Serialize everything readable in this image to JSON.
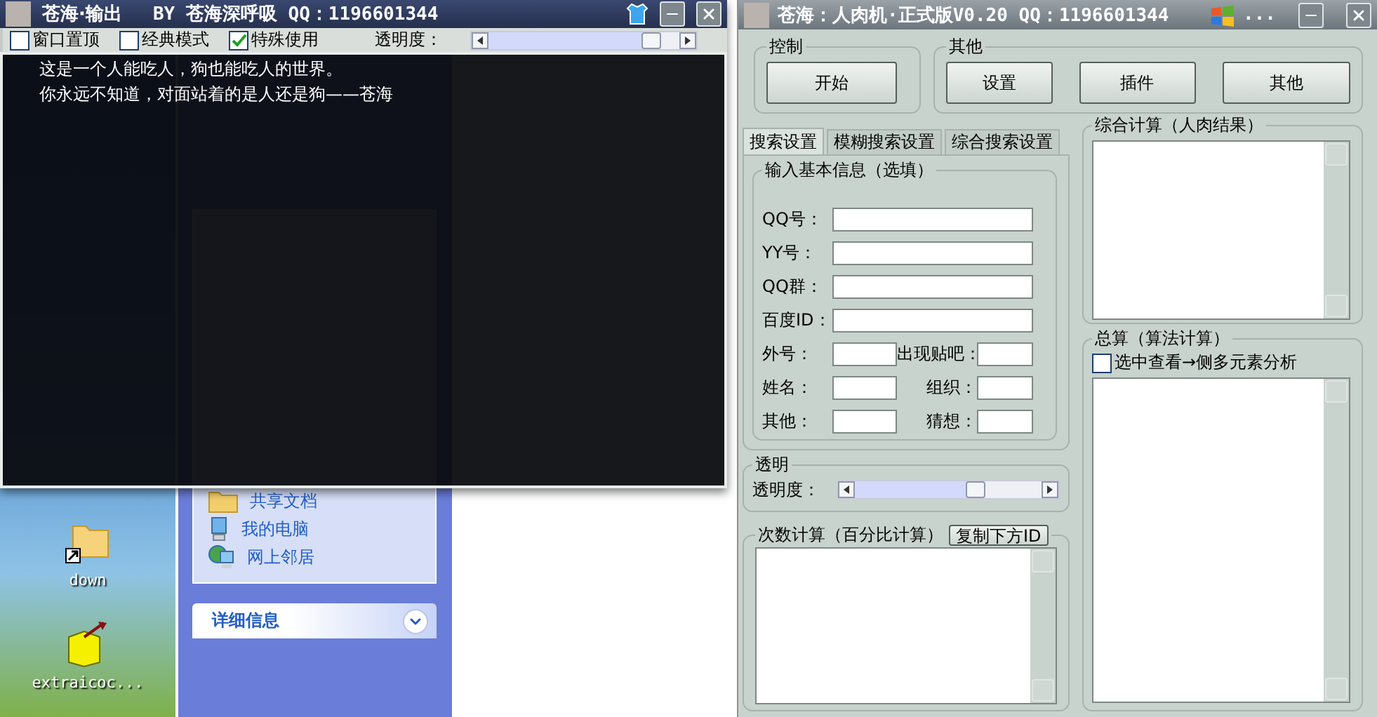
{
  "desktop": {
    "icons": [
      {
        "label": "down",
        "kind": "folder"
      },
      {
        "label": "extraicoc...",
        "kind": "package"
      }
    ]
  },
  "explorer": {
    "places": [
      {
        "label": "共享文档",
        "kind": "folder"
      },
      {
        "label": "我的电脑",
        "kind": "computer"
      },
      {
        "label": "网上邻居",
        "kind": "network"
      }
    ],
    "details": {
      "title": "详细信息",
      "expanded": false
    }
  },
  "output_window": {
    "title": "苍海·输出",
    "byline": "BY 苍海深呼吸 QQ：1196601344",
    "options": [
      {
        "label": "窗口置顶",
        "checked": false
      },
      {
        "label": "经典模式",
        "checked": false
      },
      {
        "label": "特殊使用",
        "checked": true
      }
    ],
    "opacity": {
      "label": "透明度：",
      "level": 0.85
    },
    "lines": [
      "这是一个人能吃人，狗也能吃人的世界。",
      "你永远不知道，对面站着的是人还是狗——苍海"
    ]
  },
  "main_window": {
    "title": "苍海：人肉机·正式版V0.20 QQ：1196601344",
    "title_extra": "...",
    "control": {
      "title": "控制",
      "buttons": [
        "开始"
      ]
    },
    "other": {
      "title": "其他",
      "buttons": [
        "设置",
        "插件",
        "其他"
      ]
    },
    "tabs": [
      {
        "label": "搜索设置",
        "selected": true
      },
      {
        "label": "模糊搜索设置",
        "selected": false
      },
      {
        "label": "综合搜索设置",
        "selected": false
      }
    ],
    "basic_info": {
      "title": "输入基本信息（选填）",
      "rows": [
        {
          "fields": [
            {
              "label": "QQ号："
            }
          ]
        },
        {
          "fields": [
            {
              "label": "YY号："
            }
          ]
        },
        {
          "fields": [
            {
              "label": "QQ群："
            }
          ]
        },
        {
          "fields": [
            {
              "label": "百度ID："
            }
          ]
        },
        {
          "fields": [
            {
              "label": "外号："
            },
            {
              "label": "出现贴吧："
            }
          ]
        },
        {
          "fields": [
            {
              "label": "姓名："
            },
            {
              "label": "组织："
            }
          ]
        },
        {
          "fields": [
            {
              "label": "其他："
            },
            {
              "label": "猜想："
            }
          ]
        }
      ]
    },
    "transparency": {
      "title": "透明",
      "label": "透明度：",
      "level": 0.65
    },
    "count": {
      "title": "次数计算（百分比计算）",
      "button": "复制下方ID"
    },
    "summary": {
      "title": "综合计算（人肉结果）"
    },
    "total": {
      "title": "总算（算法计算）",
      "checkbox": {
        "label": "选中查看→侧多元素分析",
        "checked": false
      }
    }
  }
}
